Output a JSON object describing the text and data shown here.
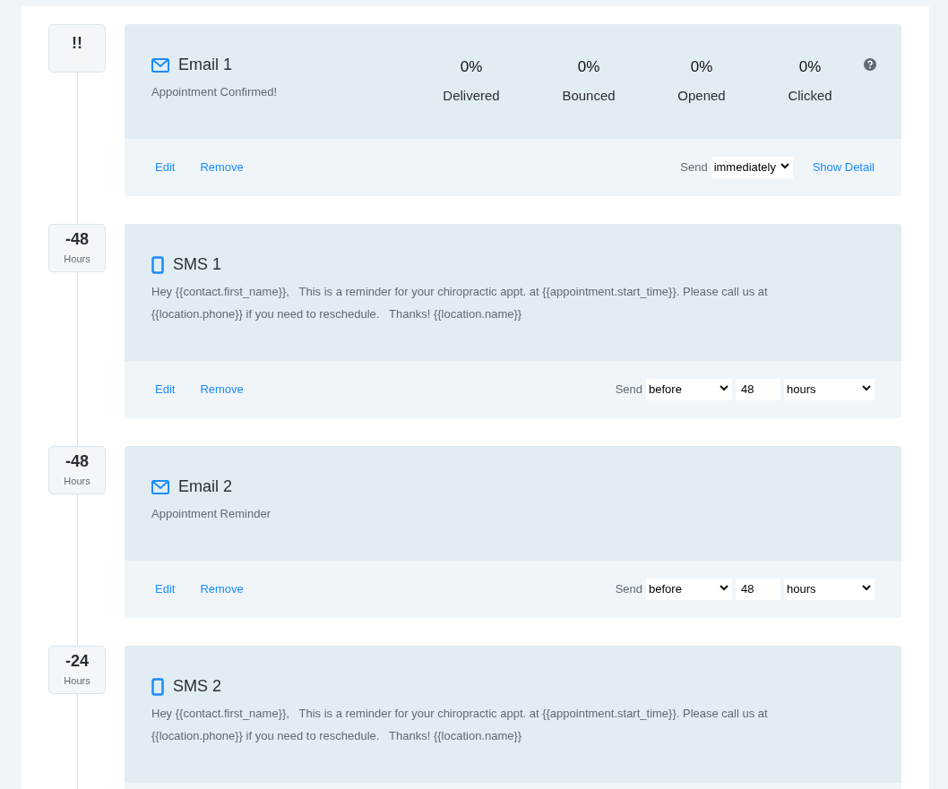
{
  "steps": [
    {
      "marker": {
        "value": "!!"
      },
      "kind": "email",
      "title": "Email 1",
      "body": "Appointment Confirmed!",
      "stats": [
        {
          "value": "0%",
          "label": "Delivered"
        },
        {
          "value": "0%",
          "label": "Bounced"
        },
        {
          "value": "0%",
          "label": "Opened"
        },
        {
          "value": "0%",
          "label": "Clicked"
        }
      ],
      "actions": [
        "Edit",
        "Remove"
      ],
      "send": {
        "label": "Send",
        "timing": "immediately"
      },
      "detail_link": "Show Detail"
    },
    {
      "marker": {
        "value": "-48",
        "unit": "Hours"
      },
      "kind": "sms",
      "title": "SMS 1",
      "body": "Hey {{contact.first_name}},   This is a reminder for your chiropractic appt. at {{appointment.start_time}}. Please call us at {{location.phone}} if you need to reschedule.   Thanks! {{location.name}}",
      "actions": [
        "Edit",
        "Remove"
      ],
      "send": {
        "label": "Send",
        "timing": "before",
        "amount": "48",
        "unit": "hours"
      }
    },
    {
      "marker": {
        "value": "-48",
        "unit": "Hours"
      },
      "kind": "email",
      "title": "Email 2",
      "body": "Appointment Reminder",
      "actions": [
        "Edit",
        "Remove"
      ],
      "send": {
        "label": "Send",
        "timing": "before",
        "amount": "48",
        "unit": "hours"
      }
    },
    {
      "marker": {
        "value": "-24",
        "unit": "Hours"
      },
      "kind": "sms",
      "title": "SMS 2",
      "body": "Hey {{contact.first_name}},   This is a reminder for your chiropractic appt. at {{appointment.start_time}}. Please call us at {{location.phone}} if you need to reschedule.   Thanks! {{location.name}}"
    }
  ]
}
